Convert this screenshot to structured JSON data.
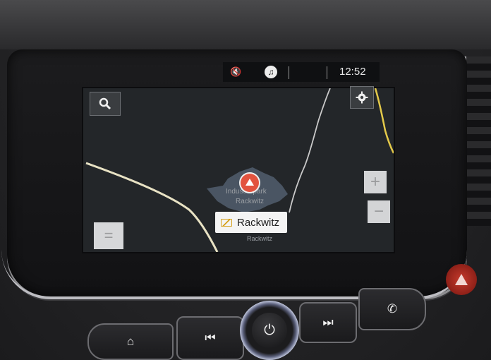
{
  "status_bar": {
    "mute_icon": "speaker-muted-icon",
    "music_icon": "music-note-icon",
    "time": "12:52"
  },
  "map": {
    "area_label_line1": "Industriepark",
    "area_label_line2": "Rackwitz",
    "below_chip_label": "Rackwitz",
    "location_chip": {
      "icon": "envelope-icon",
      "label": "Rackwitz"
    }
  },
  "map_controls": {
    "search_icon": "magnifier-icon",
    "settings_icon": "gear-icon",
    "zoom_in": "+",
    "zoom_out": "−",
    "menu": "="
  },
  "hardware_buttons": {
    "home_icon": "home-icon",
    "previous_icon": "skip-back-icon",
    "power_icon": "power-icon",
    "next_icon": "skip-forward-icon",
    "phone_icon": "phone-icon",
    "hazard_icon": "hazard-triangle-icon"
  },
  "colors": {
    "map_background": "#232629",
    "road": "#e8e2c4",
    "area": "#4a5563",
    "nav_arrow": "#e2533f"
  }
}
